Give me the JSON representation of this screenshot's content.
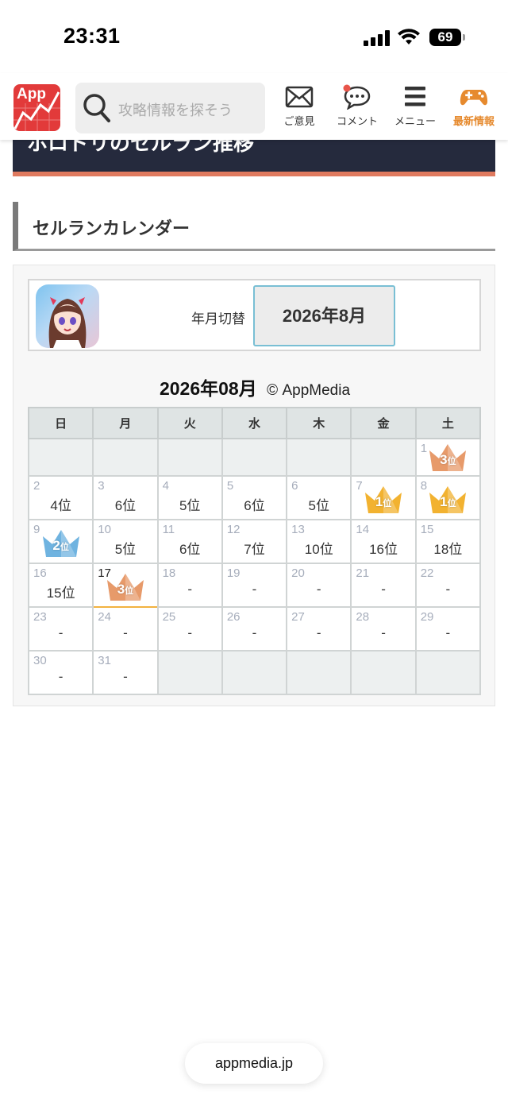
{
  "status_bar": {
    "time": "23:31",
    "battery": "69"
  },
  "header": {
    "logo_text": "App",
    "search_placeholder": "攻略情報を探そう",
    "nav": [
      {
        "label": "ご意見",
        "icon": "mail-icon"
      },
      {
        "label": "コメント",
        "icon": "comment-icon"
      },
      {
        "label": "メニュー",
        "icon": "menu-icon"
      },
      {
        "label": "最新情報",
        "icon": "gamepad-icon"
      }
    ],
    "accent_color": "#e68a2e"
  },
  "article": {
    "title": "ホロドリのセルラン推移"
  },
  "section": {
    "heading": "セルランカレンダー"
  },
  "calendar": {
    "switch_label": "年月切替",
    "selected_month": "2026年8月",
    "title": "2026年08月",
    "brand": "© AppMedia",
    "weekdays": [
      "日",
      "月",
      "火",
      "水",
      "木",
      "金",
      "土"
    ],
    "weeks": [
      [
        {
          "day": "",
          "rank": ""
        },
        {
          "day": "",
          "rank": ""
        },
        {
          "day": "",
          "rank": ""
        },
        {
          "day": "",
          "rank": ""
        },
        {
          "day": "",
          "rank": ""
        },
        {
          "day": "",
          "rank": ""
        },
        {
          "day": "1",
          "rank": "3",
          "crown": "bronze"
        }
      ],
      [
        {
          "day": "2",
          "rank": "4位"
        },
        {
          "day": "3",
          "rank": "6位"
        },
        {
          "day": "4",
          "rank": "5位"
        },
        {
          "day": "5",
          "rank": "6位"
        },
        {
          "day": "6",
          "rank": "5位"
        },
        {
          "day": "7",
          "rank": "1",
          "crown": "gold"
        },
        {
          "day": "8",
          "rank": "1",
          "crown": "gold"
        }
      ],
      [
        {
          "day": "9",
          "rank": "2",
          "crown": "silver"
        },
        {
          "day": "10",
          "rank": "5位"
        },
        {
          "day": "11",
          "rank": "6位"
        },
        {
          "day": "12",
          "rank": "7位"
        },
        {
          "day": "13",
          "rank": "10位"
        },
        {
          "day": "14",
          "rank": "16位"
        },
        {
          "day": "15",
          "rank": "18位"
        }
      ],
      [
        {
          "day": "16",
          "rank": "15位"
        },
        {
          "day": "17",
          "rank": "3",
          "crown": "bronze",
          "today": true
        },
        {
          "day": "18",
          "rank": "-"
        },
        {
          "day": "19",
          "rank": "-"
        },
        {
          "day": "20",
          "rank": "-"
        },
        {
          "day": "21",
          "rank": "-"
        },
        {
          "day": "22",
          "rank": "-"
        }
      ],
      [
        {
          "day": "23",
          "rank": "-"
        },
        {
          "day": "24",
          "rank": "-"
        },
        {
          "day": "25",
          "rank": "-"
        },
        {
          "day": "26",
          "rank": "-"
        },
        {
          "day": "27",
          "rank": "-"
        },
        {
          "day": "28",
          "rank": "-"
        },
        {
          "day": "29",
          "rank": "-"
        }
      ],
      [
        {
          "day": "30",
          "rank": "-"
        },
        {
          "day": "31",
          "rank": "-"
        },
        {
          "day": "",
          "rank": ""
        },
        {
          "day": "",
          "rank": ""
        },
        {
          "day": "",
          "rank": ""
        },
        {
          "day": "",
          "rank": ""
        },
        {
          "day": "",
          "rank": ""
        }
      ]
    ],
    "crown_suffix": "位",
    "crown_colors": {
      "gold": "#f2b230",
      "silver": "#6fb3e0",
      "bronze": "#e79a6a"
    }
  },
  "browser": {
    "url": "appmedia.jp"
  }
}
